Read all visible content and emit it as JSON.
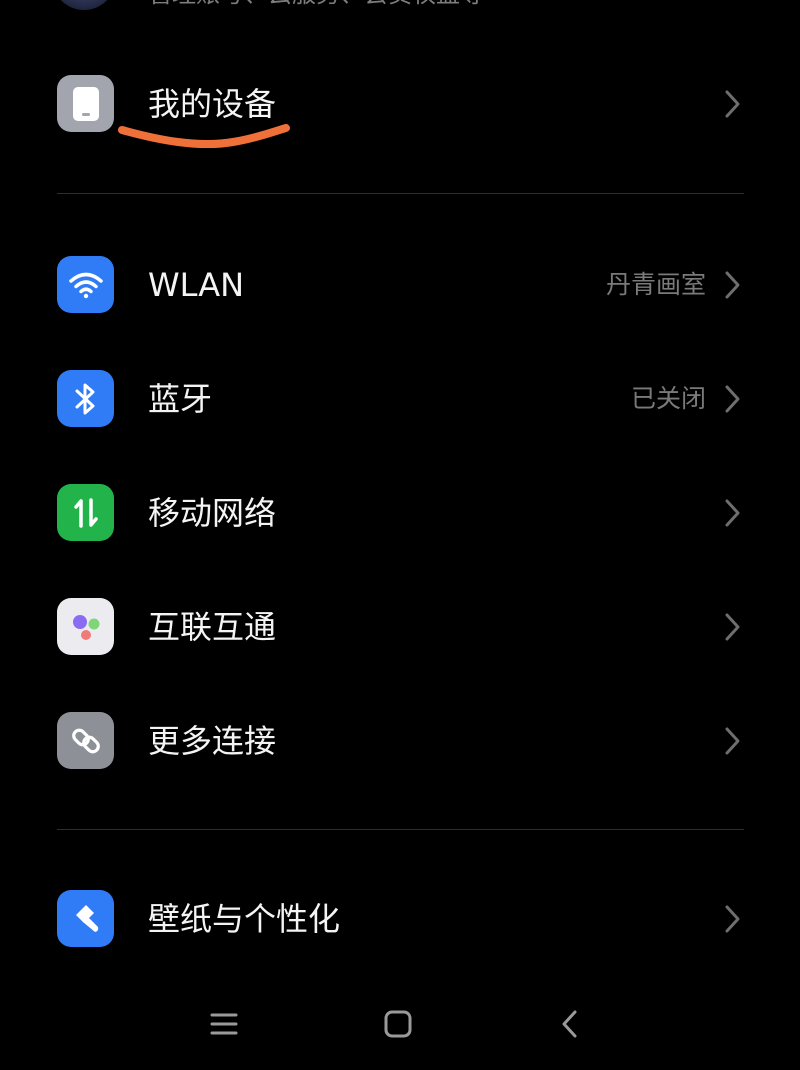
{
  "account": {
    "subtitle": "管理账号、云服务、会员权益等"
  },
  "my_device": {
    "label": "我的设备"
  },
  "connections": [
    {
      "id": "wlan",
      "label": "WLAN",
      "value": "丹青画室",
      "icon": "wifi-icon",
      "color": "#2f7cf6"
    },
    {
      "id": "bluetooth",
      "label": "蓝牙",
      "value": "已关闭",
      "icon": "bluetooth-icon",
      "color": "#2f7cf6"
    },
    {
      "id": "mobile-network",
      "label": "移动网络",
      "value": "",
      "icon": "mobile-data-icon",
      "color": "#22b34a"
    },
    {
      "id": "interconnect",
      "label": "互联互通",
      "value": "",
      "icon": "interconnect-icon",
      "color": "#ececf0"
    },
    {
      "id": "more-connections",
      "label": "更多连接",
      "value": "",
      "icon": "link-icon",
      "color": "#8e9098"
    }
  ],
  "personalization": {
    "label": "壁纸与个性化",
    "icon": "brush-icon",
    "color": "#2f7cf6"
  },
  "colors": {
    "background": "#000000",
    "annotation_underline": "#f0703a",
    "device_icon": "#a2a4ae"
  }
}
